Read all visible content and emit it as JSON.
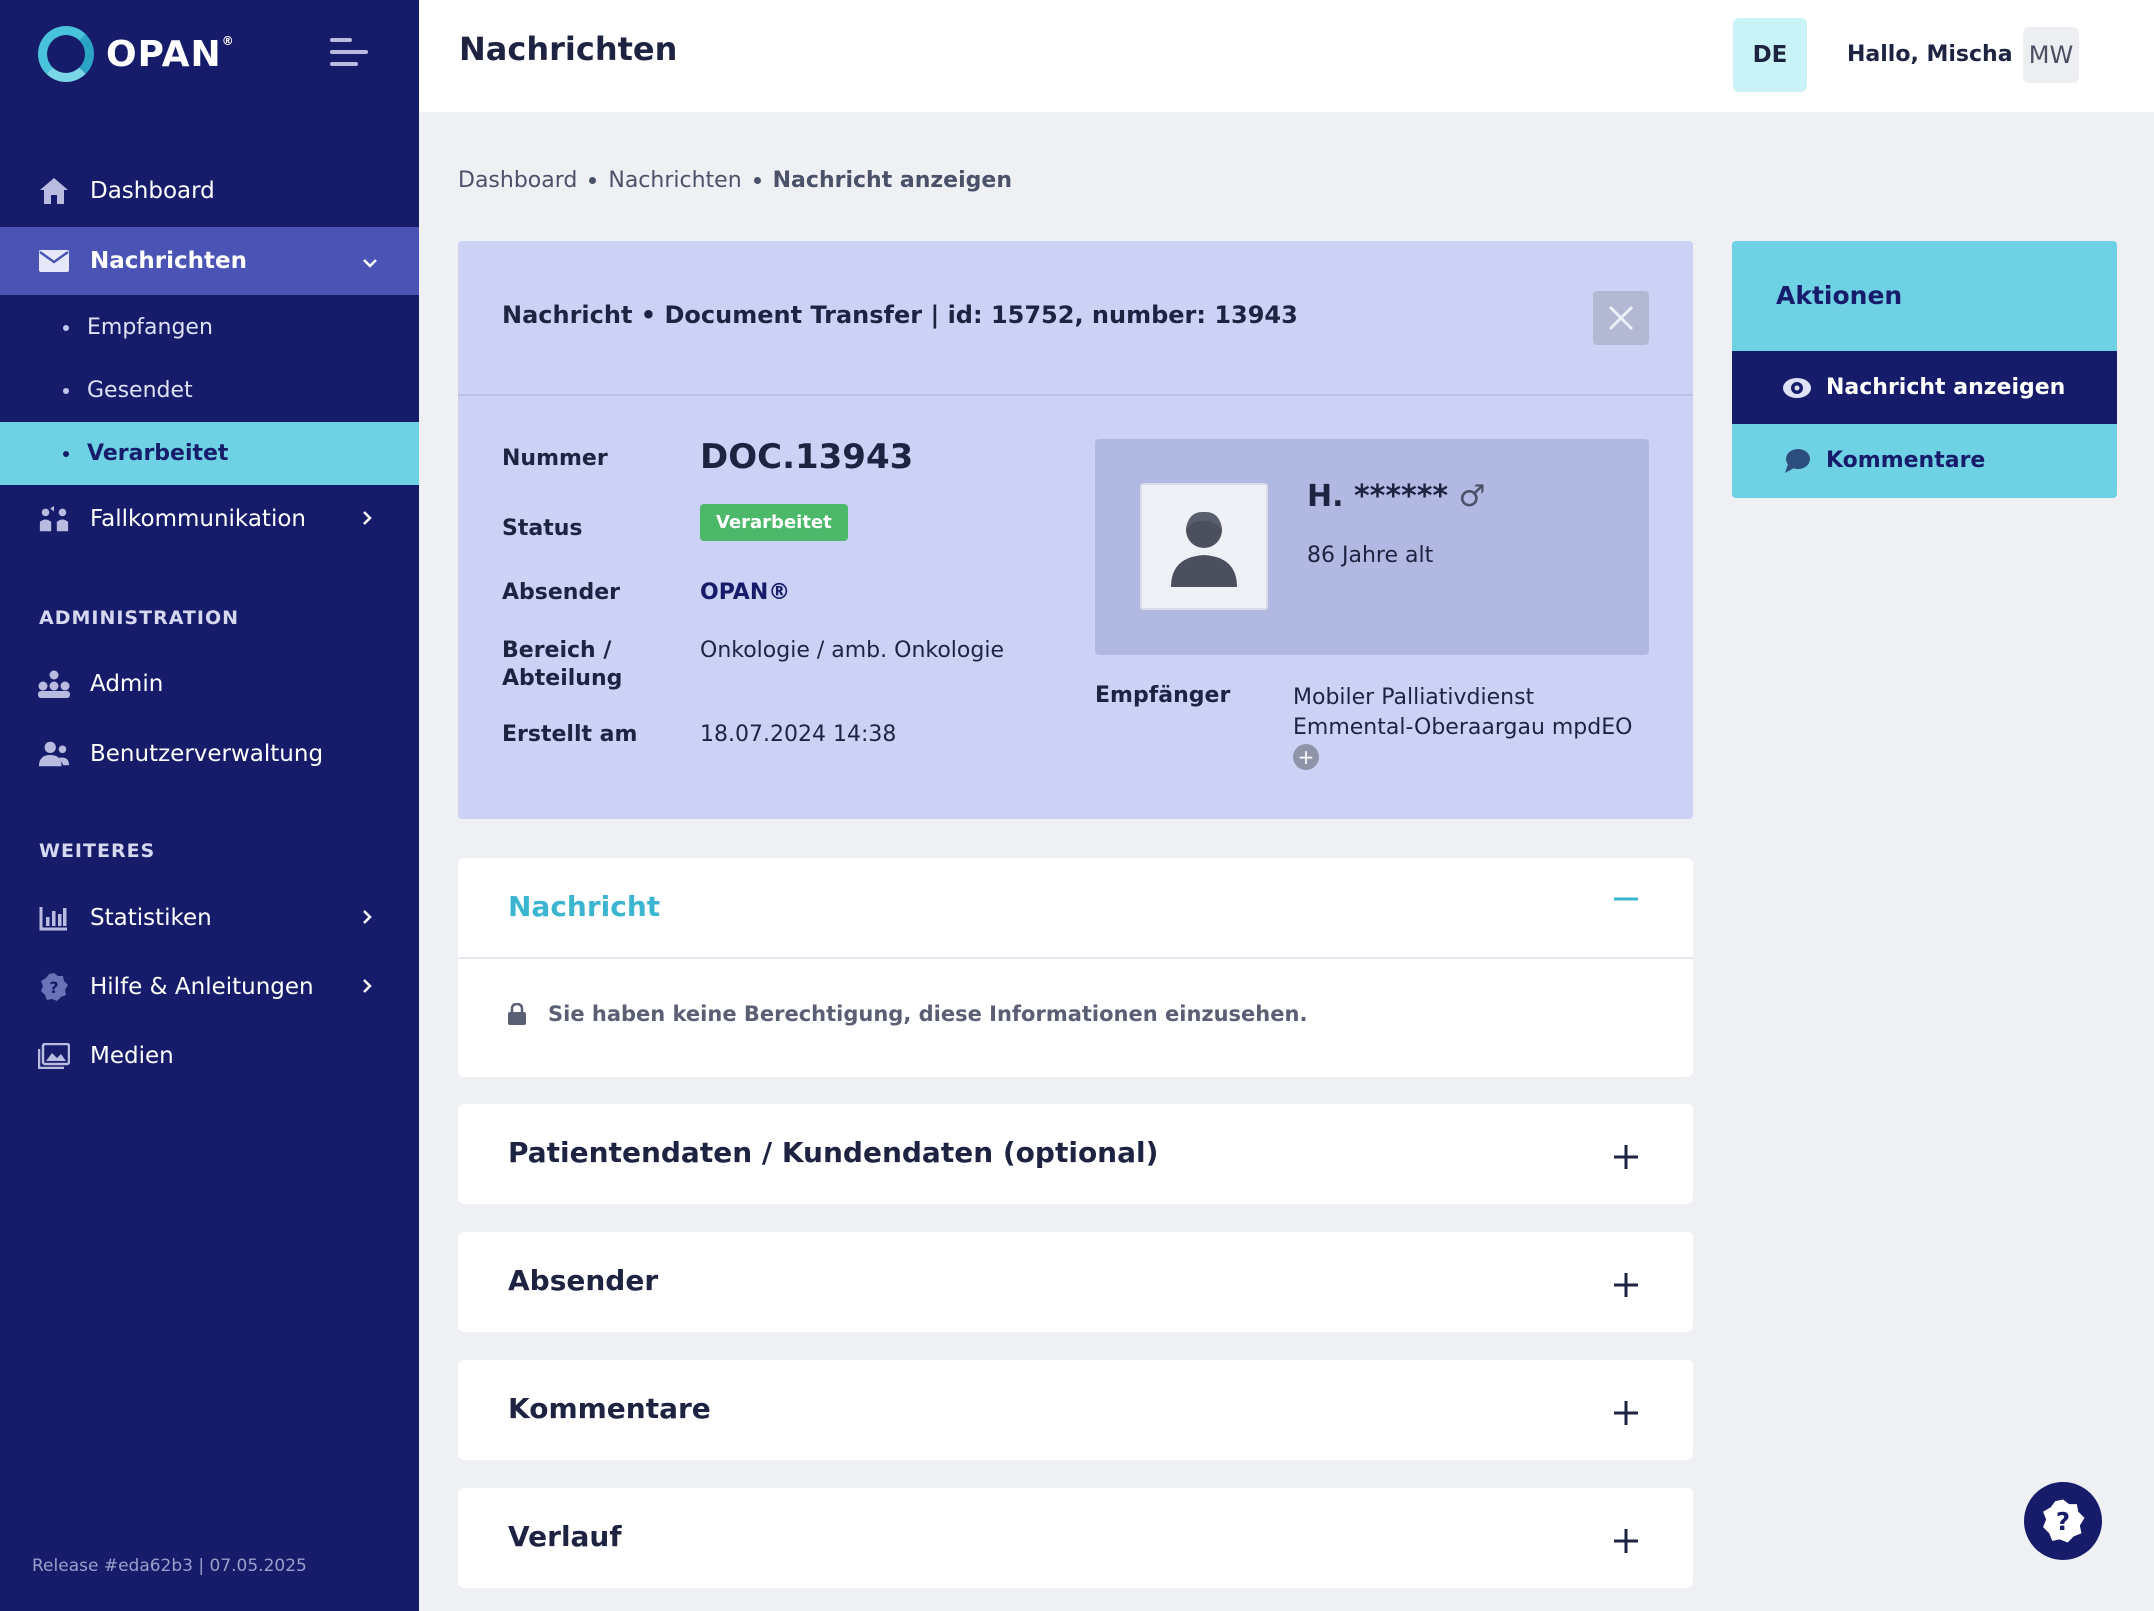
{
  "brand": {
    "name": "OPAN",
    "mark": "®"
  },
  "sidebar": {
    "items": [
      {
        "label": "Dashboard",
        "icon": "home-icon"
      },
      {
        "label": "Nachrichten",
        "icon": "envelope-icon"
      },
      {
        "label": "Fallkommunikation",
        "icon": "people-exchange-icon"
      }
    ],
    "sub_items": [
      {
        "label": "Empfangen"
      },
      {
        "label": "Gesendet"
      },
      {
        "label": "Verarbeitet"
      }
    ],
    "admin_heading": "ADMINISTRATION",
    "admin_items": [
      {
        "label": "Admin",
        "icon": "org-chart-icon"
      },
      {
        "label": "Benutzerverwaltung",
        "icon": "users-icon"
      }
    ],
    "more_heading": "WEITERES",
    "more_items": [
      {
        "label": "Statistiken",
        "icon": "bar-chart-icon"
      },
      {
        "label": "Hilfe & Anleitungen",
        "icon": "help-badge-icon"
      },
      {
        "label": "Medien",
        "icon": "image-gallery-icon"
      }
    ],
    "release": "Release #eda62b3 | 07.05.2025"
  },
  "header": {
    "title": "Nachrichten",
    "language": "DE",
    "greeting": "Hallo,  Mischa",
    "user_initials": "MW"
  },
  "breadcrumb": [
    "Dashboard",
    "Nachrichten",
    "Nachricht anzeigen"
  ],
  "message": {
    "title": "Nachricht • Document Transfer | id: 15752, number: 13943",
    "fields": {
      "number_label": "Nummer",
      "number_value": "DOC.13943",
      "status_label": "Status",
      "status_value": "Verarbeitet",
      "sender_label": "Absender",
      "sender_value": "OPAN®",
      "area_label_1": "Bereich /",
      "area_label_2": "Abteilung",
      "area_value": "Onkologie / amb. Onkologie",
      "created_label": "Erstellt am",
      "created_value": "18.07.2024 14:38"
    },
    "patient": {
      "name": "H. ******",
      "gender_symbol": "♂",
      "age": "86 Jahre alt"
    },
    "recipient_label": "Empfänger",
    "recipient_value": "Mobiler Palliativdienst Emmental-Oberaargau mpdEO"
  },
  "accordions": [
    {
      "title": "Nachricht",
      "state": "open",
      "message": "Sie haben keine Berechtigung, diese Informationen einzusehen."
    },
    {
      "title": "Patientendaten / Kundendaten (optional)",
      "state": "closed"
    },
    {
      "title": "Absender",
      "state": "closed"
    },
    {
      "title": "Kommentare",
      "state": "closed"
    },
    {
      "title": "Verlauf",
      "state": "closed"
    }
  ],
  "actions": {
    "heading": "Aktionen",
    "items": [
      {
        "label": "Nachricht anzeigen",
        "icon": "eye-icon"
      },
      {
        "label": "Kommentare",
        "icon": "speech-bubble-icon"
      }
    ]
  },
  "colors": {
    "sidebar_bg": "#161c6a",
    "accent_cyan": "#6fd1e4",
    "status_green": "#4cb86a",
    "card_bg": "#ccd2f6"
  }
}
